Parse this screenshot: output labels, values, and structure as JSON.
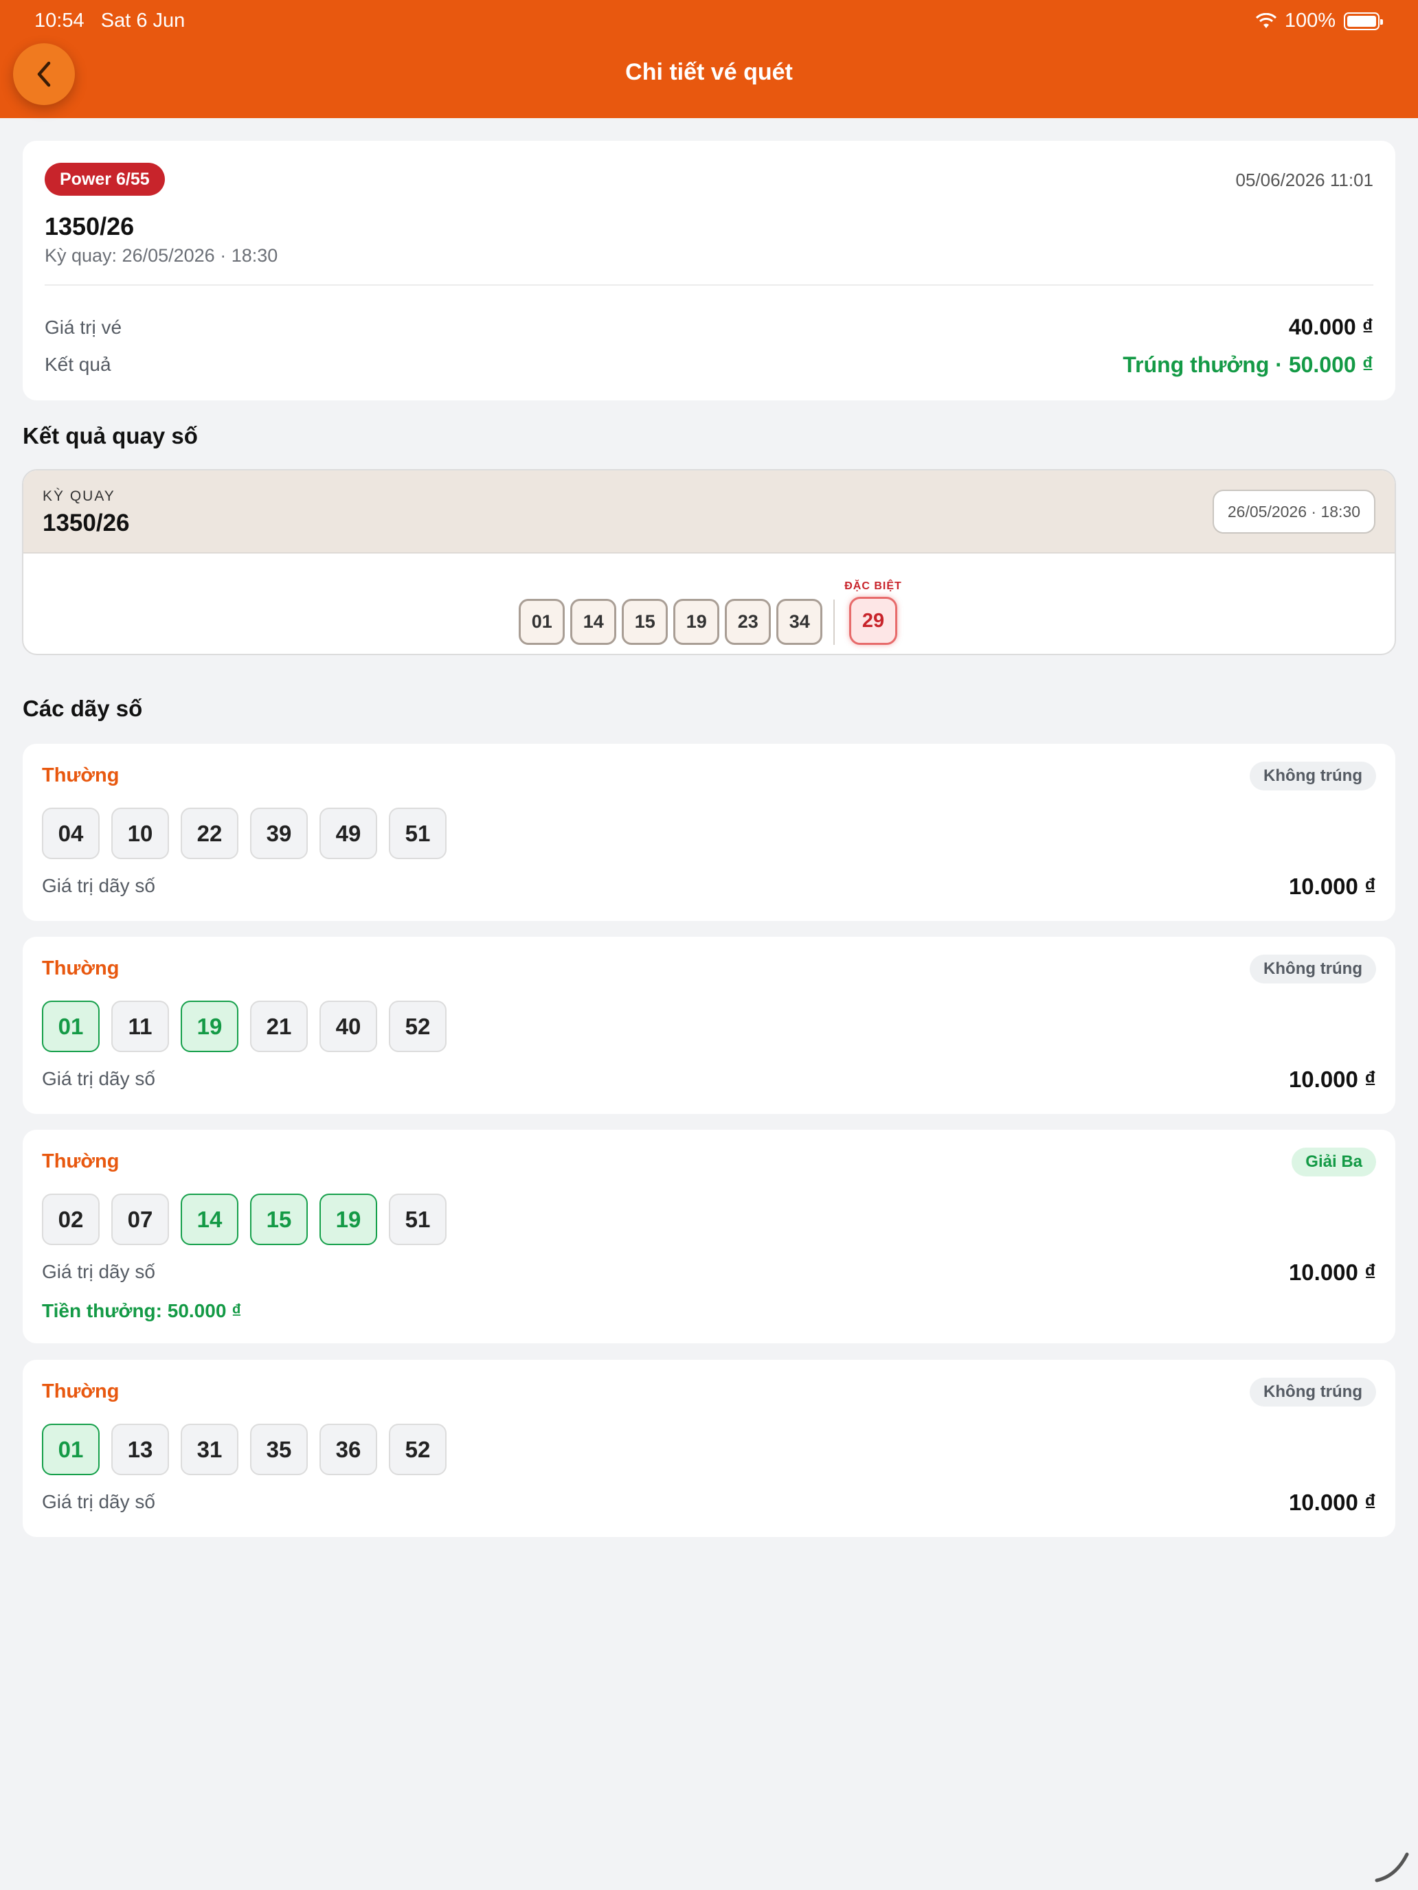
{
  "status_bar": {
    "time": "10:54",
    "date": "Sat 6 Jun",
    "battery": "100%"
  },
  "header": {
    "title": "Chi tiết vé quét"
  },
  "ticket": {
    "game": "Power 6/55",
    "scanned_at": "05/06/2026 11:01",
    "code": "1350/26",
    "draw_info": "Kỳ quay: 26/05/2026 · 18:30",
    "value_label": "Giá trị vé",
    "value": "40.000 ₫",
    "result_label": "Kết quả",
    "result": "Trúng thưởng · 50.000 ₫"
  },
  "draw": {
    "section_title": "Kết quả quay số",
    "label": "KỲ QUAY",
    "code": "1350/26",
    "date": "26/05/2026 · 18:30",
    "balls": [
      "01",
      "14",
      "15",
      "19",
      "23",
      "34"
    ],
    "special_label": "ĐẶC BIỆT",
    "special": "29"
  },
  "sequences_title": "Các dãy số",
  "sequences": [
    {
      "type": "Thường",
      "status": "Không trúng",
      "win": false,
      "balls": [
        [
          "04",
          false
        ],
        [
          "10",
          false
        ],
        [
          "22",
          false
        ],
        [
          "39",
          false
        ],
        [
          "49",
          false
        ],
        [
          "51",
          false
        ]
      ],
      "value_label": "Giá trị dãy số",
      "value": "10.000 ₫",
      "prize": ""
    },
    {
      "type": "Thường",
      "status": "Không trúng",
      "win": false,
      "balls": [
        [
          "01",
          true
        ],
        [
          "11",
          false
        ],
        [
          "19",
          true
        ],
        [
          "21",
          false
        ],
        [
          "40",
          false
        ],
        [
          "52",
          false
        ]
      ],
      "value_label": "Giá trị dãy số",
      "value": "10.000 ₫",
      "prize": ""
    },
    {
      "type": "Thường",
      "status": "Giải Ba",
      "win": true,
      "balls": [
        [
          "02",
          false
        ],
        [
          "07",
          false
        ],
        [
          "14",
          true
        ],
        [
          "15",
          true
        ],
        [
          "19",
          true
        ],
        [
          "51",
          false
        ]
      ],
      "value_label": "Giá trị dãy số",
      "value": "10.000 ₫",
      "prize": "Tiền thưởng: 50.000 ₫"
    },
    {
      "type": "Thường",
      "status": "Không trúng",
      "win": false,
      "balls": [
        [
          "01",
          true
        ],
        [
          "13",
          false
        ],
        [
          "31",
          false
        ],
        [
          "35",
          false
        ],
        [
          "36",
          false
        ],
        [
          "52",
          false
        ]
      ],
      "value_label": "Giá trị dãy số",
      "value": "10.000 ₫",
      "prize": ""
    }
  ],
  "colors": {
    "brand": "#e8580f",
    "win": "#149a46",
    "special": "#c8242b"
  }
}
